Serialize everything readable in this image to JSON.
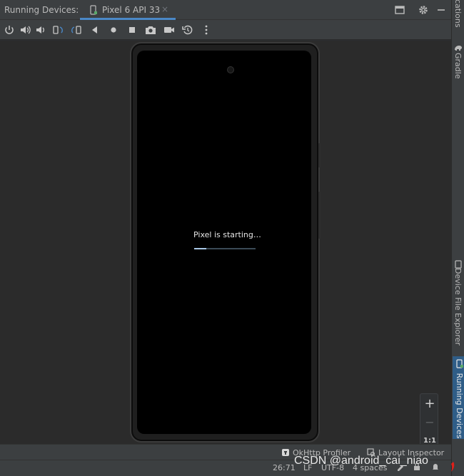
{
  "header": {
    "title": "Running Devices:",
    "tab_label": "Pixel 6 API 33",
    "tab_close": "×"
  },
  "toolbar": {
    "icons": [
      "power-icon",
      "volume-up-icon",
      "volume-down-icon",
      "rotate-left-icon",
      "rotate-right-icon",
      "back-icon",
      "home-icon",
      "overview-icon",
      "screenshot-icon",
      "screen-record-icon",
      "snapshot-icon",
      "more-icon"
    ]
  },
  "device": {
    "boot_text": "Pixel is starting…",
    "progress": 0.2
  },
  "zoom": {
    "zoom_in": "+",
    "zoom_out": "−",
    "actual_size": "1:1"
  },
  "right_strip": {
    "notifications": "cations",
    "gradle": "Gradle",
    "device_file_explorer": "Device File Explorer",
    "running_devices": "Running Devices"
  },
  "bottom_tools": {
    "okhttp_profiler": "OkHttp Profiler",
    "layout_inspector": "Layout Inspector"
  },
  "status": {
    "position": "26:71",
    "line_sep": "LF",
    "encoding": "UTF-8",
    "indent": "4 spaces"
  },
  "watermark": "CSDN @android_cai_niao",
  "colors": {
    "accent": "#4a88c7",
    "panel": "#3c3f41",
    "background": "#2b2b2b",
    "screen": "#000000"
  }
}
